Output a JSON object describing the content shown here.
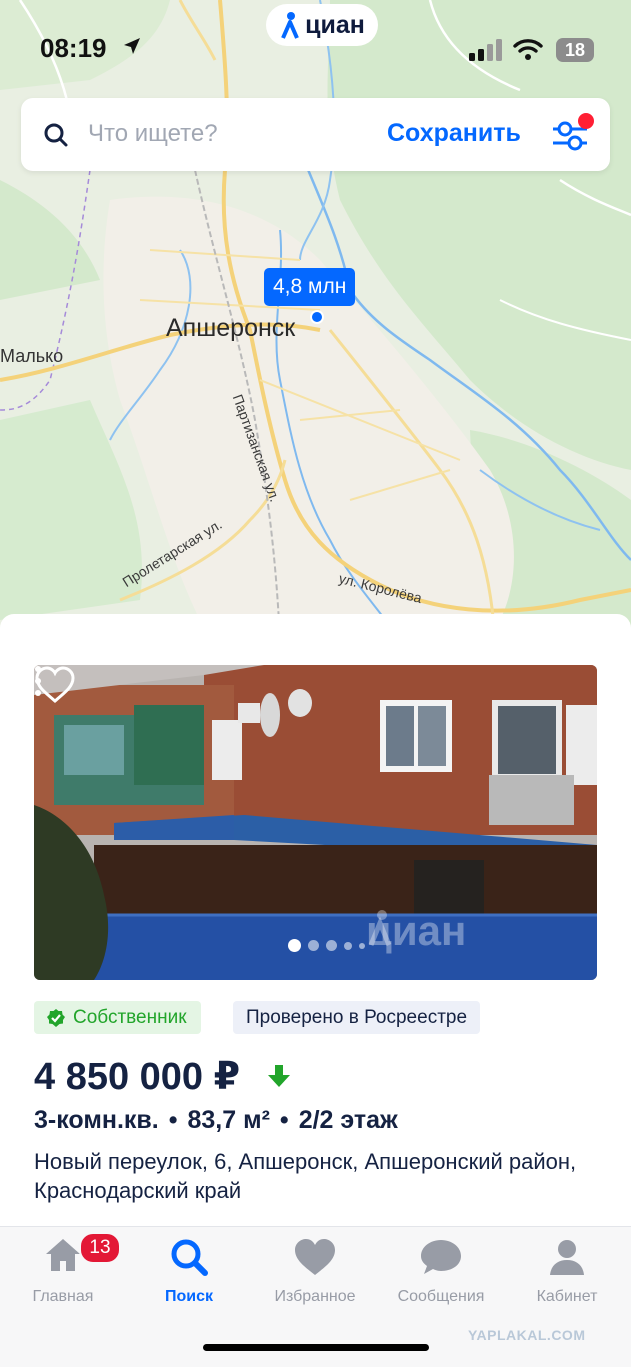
{
  "status_bar": {
    "time": "08:19",
    "battery": "18"
  },
  "brand": {
    "name": "циан"
  },
  "search": {
    "placeholder": "Что ищете?",
    "save_label": "Сохранить"
  },
  "map": {
    "city": "Апшеронск",
    "neighbor_town": "Малько",
    "streets": [
      "Партизанская ул.",
      "Пролетарская ул.",
      "ул. Королёва"
    ],
    "marker_price": "4,8 млн"
  },
  "listing": {
    "badges": {
      "owner": "Собственник",
      "verified": "Проверено в Росреестре"
    },
    "price": "4 850 000 ₽",
    "rooms": "3-комн.кв.",
    "area": "83,7 м²",
    "floor": "2/2 этаж",
    "address": "Новый переулок, 6, Апшеронск, Апшеронский район, Краснодарский край",
    "photo_watermark": "циан"
  },
  "tabbar": {
    "items": [
      {
        "label": "Главная",
        "icon": "home-icon"
      },
      {
        "label": "Поиск",
        "icon": "search-icon"
      },
      {
        "label": "Избранное",
        "icon": "heart-icon"
      },
      {
        "label": "Сообщения",
        "icon": "chat-icon"
      },
      {
        "label": "Кабинет",
        "icon": "user-icon"
      }
    ],
    "home_badge": "13"
  },
  "watermark_site": "YAPLAKAL.COM",
  "colors": {
    "accent": "#0468ff",
    "text": "#152242",
    "owner_green": "#22a52b",
    "badge_red": "#e31836"
  }
}
